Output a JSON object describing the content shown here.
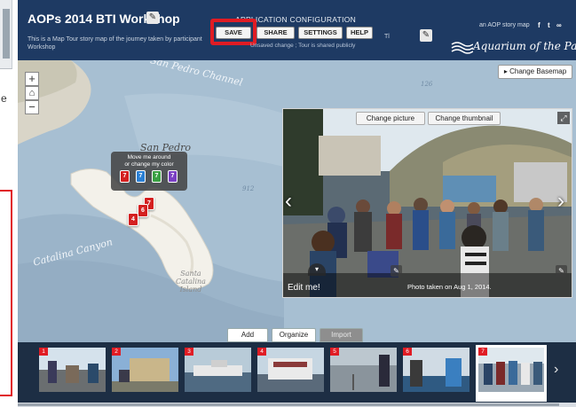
{
  "left_fragment": {
    "letter": "e"
  },
  "header": {
    "title": "AOPs 2014 BTI Workshop",
    "subtitle": "This is a Map Tour story map of the journey taken by participant Workshop",
    "config_title": "APPLICATION CONFIGURATION",
    "buttons": {
      "save": "SAVE",
      "share": "SHARE",
      "settings": "SETTINGS",
      "help": "HELP"
    },
    "status": "Unsaved change ; Tour is shared publicly",
    "tl_text": "Tl",
    "storymap_link": "an AOP story map",
    "social": {
      "facebook": "f",
      "twitter": "t",
      "link": "∞"
    },
    "logo_text": "Aquarium of the Pacific",
    "colors": {
      "header_bg": "#1e3a63",
      "highlight": "#e01c24"
    }
  },
  "map": {
    "labels": {
      "channel": "San Pedro Channel",
      "san_pedro": "San Pedro",
      "canyon": "Catalina Canyon",
      "island": "Santa\nCatalina\nIsland"
    },
    "depths": {
      "d126": "126",
      "d912": "912"
    },
    "zoom": {
      "in": "+",
      "home": "⌂",
      "out": "−"
    },
    "change_basemap": "▸ Change Basemap",
    "tooltip": {
      "text": "Move me around\nor change my color",
      "pins": [
        {
          "num": "7",
          "color": "#d42020"
        },
        {
          "num": "7",
          "color": "#2a7fd4"
        },
        {
          "num": "7",
          "color": "#3aa043"
        },
        {
          "num": "7",
          "color": "#7a3fc4"
        }
      ]
    },
    "pins": [
      {
        "num": "7"
      },
      {
        "num": "6"
      },
      {
        "num": "4"
      }
    ]
  },
  "media": {
    "change_picture": "Change picture",
    "change_thumbnail": "Change thumbnail",
    "edit_me": "Edit me!",
    "caption": "Photo taken on Aug 1, 2014."
  },
  "tabs": [
    {
      "label": "Add",
      "active": false
    },
    {
      "label": "Organize",
      "active": false
    },
    {
      "label": "Import",
      "active": true
    }
  ],
  "carousel": {
    "items": [
      {
        "num": "1"
      },
      {
        "num": "2"
      },
      {
        "num": "3"
      },
      {
        "num": "4"
      },
      {
        "num": "5"
      },
      {
        "num": "6"
      },
      {
        "num": "7",
        "selected": true
      }
    ],
    "next_arrow": "›"
  }
}
